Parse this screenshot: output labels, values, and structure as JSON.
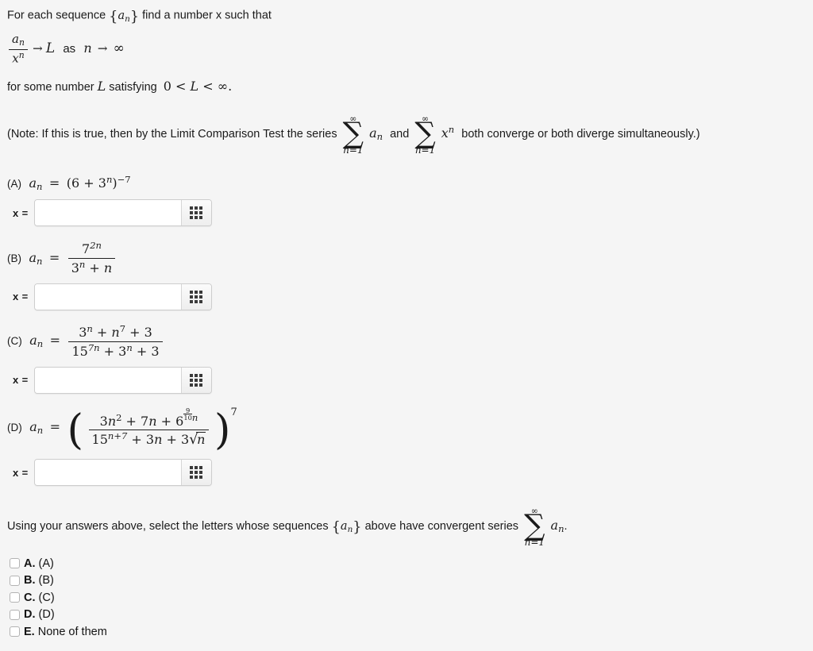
{
  "prompt": {
    "line1_a": "For each sequence",
    "line1_seq": "{a_n}",
    "line1_b": "find a number x such that",
    "limit_num": "a_n",
    "limit_den": "x^n",
    "arrow": "→",
    "limit_L": "L",
    "as_word": "as",
    "n_var": "n",
    "arrow2": "→",
    "infinity": "∞",
    "forsome_a": "for some number",
    "forsome_L": "L",
    "forsome_b": "satisfying",
    "forsome_cond": "0 < L < ∞."
  },
  "note": {
    "text_before": "(Note: If this is true, then by the Limit Comparison Test the series",
    "sum1": {
      "top": "∞",
      "sigma": "∑",
      "bottom": "n=1",
      "body": "a_n"
    },
    "and_word": "and",
    "sum2": {
      "top": "∞",
      "sigma": "∑",
      "bottom": "n=1",
      "body": "x^n"
    },
    "text_after": "both converge or both diverge simultaneously.)"
  },
  "parts": [
    {
      "label": "(A)",
      "lhs": "a_n",
      "eq": "=",
      "formula_plain": "(6 + 3^n)^{-7}",
      "base_open": "(",
      "base_six": "6",
      "plus": "+",
      "base_three": "3",
      "exp_n": "n",
      "base_close": ")",
      "outer_exp": "−7",
      "answer": {
        "label": "x =",
        "value": "",
        "placeholder": "",
        "icon": "grid-icon"
      }
    },
    {
      "label": "(B)",
      "lhs": "a_n",
      "eq": "=",
      "formula_plain": "7^{2n} / (3^n + n)",
      "num_base": "7",
      "num_exp": "2n",
      "den": "3^n + n",
      "den_base": "3",
      "den_exp": "n",
      "den_tail": "+ n",
      "answer": {
        "label": "x =",
        "value": "",
        "placeholder": "",
        "icon": "grid-icon"
      }
    },
    {
      "label": "(C)",
      "lhs": "a_n",
      "eq": "=",
      "formula_plain": "(3^n + n^7 + 3) / (15^{7n} + 3^n + 3)",
      "num": "3^n + n^7 + 3",
      "den": "15^{7n} + 3^n + 3",
      "answer": {
        "label": "x =",
        "value": "",
        "placeholder": "",
        "icon": "grid-icon"
      }
    },
    {
      "label": "(D)",
      "lhs": "a_n",
      "eq": "=",
      "formula_plain": "((3n^2 + 7n + 6^{(9/10)n}) / (15^{n+7} + 3n + 3√n))^7",
      "num": "3n^2 + 7n + 6^{(9/10)n}",
      "den": "15^{n+7} + 3n + 3√n",
      "outer_exp": "7",
      "answer": {
        "label": "x =",
        "value": "",
        "placeholder": "",
        "icon": "grid-icon"
      }
    }
  ],
  "final_question": {
    "text_before": "Using your answers above, select the letters whose sequences",
    "seq": "{a_n}",
    "text_mid": "above have convergent series",
    "sum": {
      "top": "∞",
      "sigma": "∑",
      "bottom": "n=1",
      "body": "a_n"
    },
    "period": "."
  },
  "choices": [
    {
      "key": "A.",
      "text": "(A)"
    },
    {
      "key": "B.",
      "text": "(B)"
    },
    {
      "key": "C.",
      "text": "(C)"
    },
    {
      "key": "D.",
      "text": "(D)"
    },
    {
      "key": "E.",
      "text": "None of them"
    }
  ],
  "colors": {
    "background": "#f5f5f5",
    "text": "#1a1a1a",
    "input_border": "#cdcdcd",
    "input_bg": "#ffffff",
    "button_bg": "#eeeeee",
    "icon_dot": "#3a3a3a"
  }
}
